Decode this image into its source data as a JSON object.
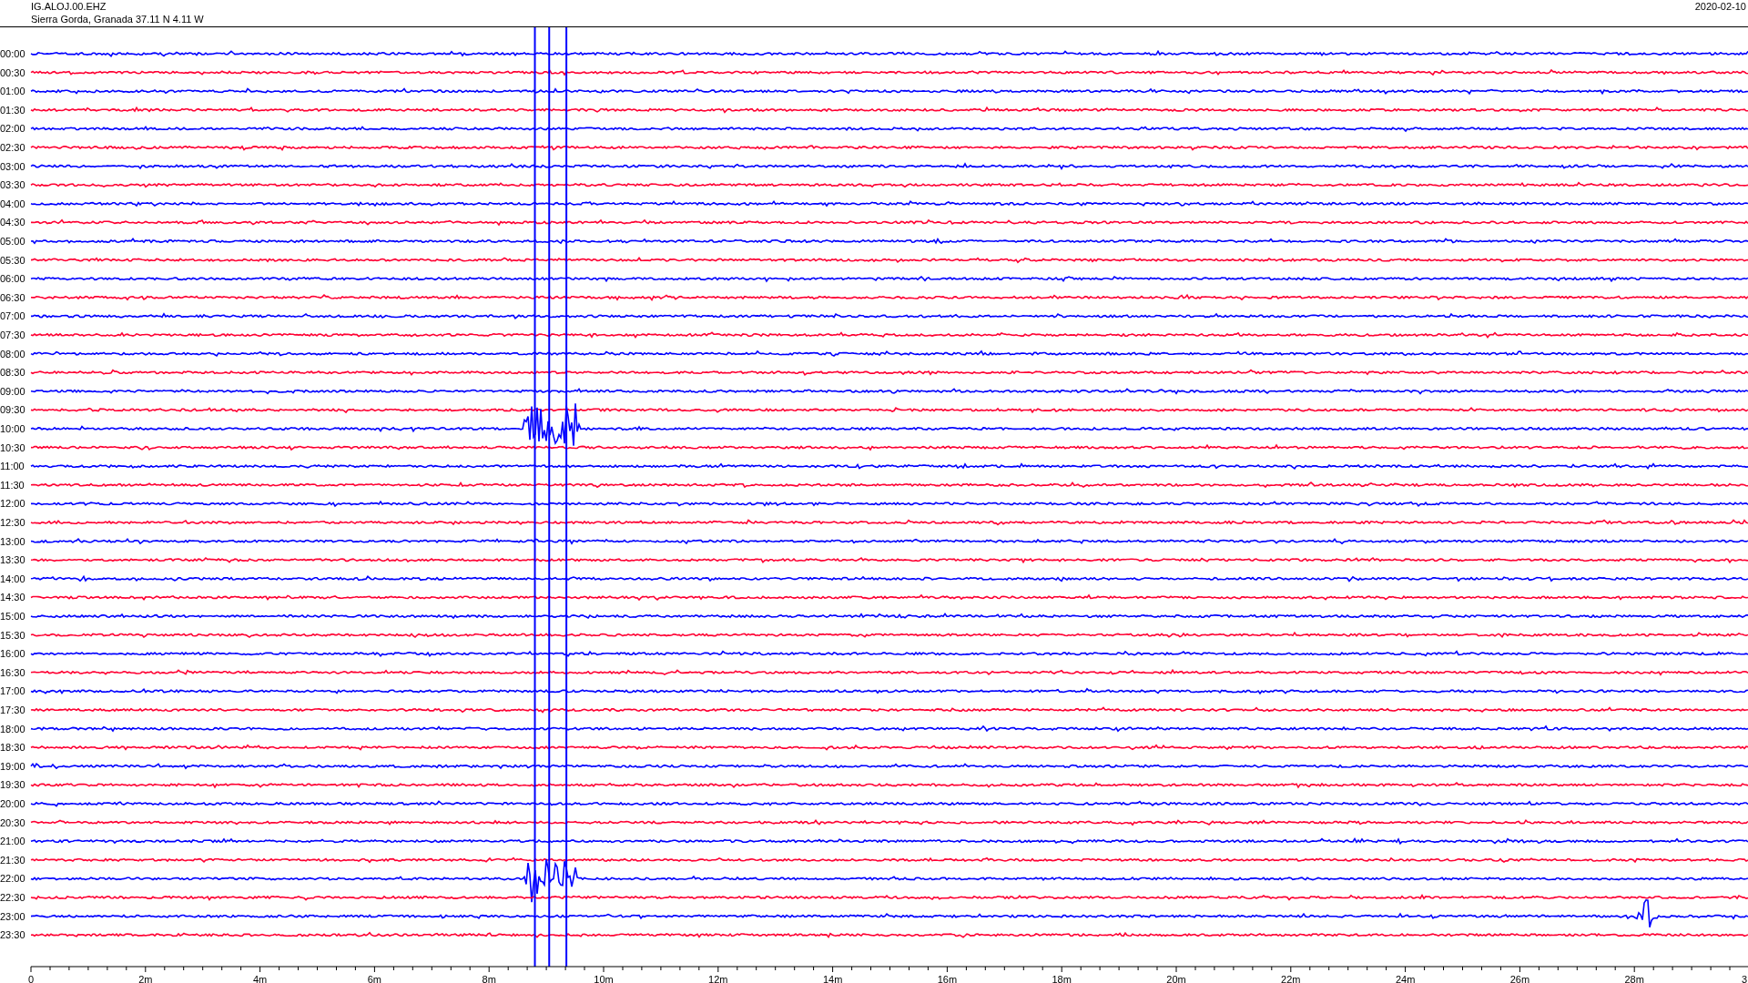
{
  "header": {
    "station": "IG.ALOJ.00.EHZ",
    "location": "Sierra Gorda, Granada  37.11 N 4.11 W",
    "date": "2020-02-10"
  },
  "rows": [
    {
      "label": "00:00",
      "color": "#0000ff"
    },
    {
      "label": "00:30",
      "color": "#ff0033"
    },
    {
      "label": "01:00",
      "color": "#0000ff"
    },
    {
      "label": "01:30",
      "color": "#ff0033"
    },
    {
      "label": "02:00",
      "color": "#0000ff"
    },
    {
      "label": "02:30",
      "color": "#ff0033"
    },
    {
      "label": "03:00",
      "color": "#0000ff"
    },
    {
      "label": "03:30",
      "color": "#ff0033"
    },
    {
      "label": "04:00",
      "color": "#0000ff"
    },
    {
      "label": "04:30",
      "color": "#ff0033"
    },
    {
      "label": "05:00",
      "color": "#0000ff"
    },
    {
      "label": "05:30",
      "color": "#ff0033"
    },
    {
      "label": "06:00",
      "color": "#0000ff"
    },
    {
      "label": "06:30",
      "color": "#ff0033"
    },
    {
      "label": "07:00",
      "color": "#0000ff"
    },
    {
      "label": "07:30",
      "color": "#ff0033"
    },
    {
      "label": "08:00",
      "color": "#0000ff"
    },
    {
      "label": "08:30",
      "color": "#ff0033"
    },
    {
      "label": "09:00",
      "color": "#0000ff"
    },
    {
      "label": "09:30",
      "color": "#ff0033"
    },
    {
      "label": "10:00",
      "color": "#0000ff"
    },
    {
      "label": "10:30",
      "color": "#ff0033"
    },
    {
      "label": "11:00",
      "color": "#0000ff"
    },
    {
      "label": "11:30",
      "color": "#ff0033"
    },
    {
      "label": "12:00",
      "color": "#0000ff"
    },
    {
      "label": "12:30",
      "color": "#ff0033"
    },
    {
      "label": "13:00",
      "color": "#0000ff"
    },
    {
      "label": "13:30",
      "color": "#ff0033"
    },
    {
      "label": "14:00",
      "color": "#0000ff"
    },
    {
      "label": "14:30",
      "color": "#ff0033"
    },
    {
      "label": "15:00",
      "color": "#0000ff"
    },
    {
      "label": "15:30",
      "color": "#ff0033"
    },
    {
      "label": "16:00",
      "color": "#0000ff"
    },
    {
      "label": "16:30",
      "color": "#ff0033"
    },
    {
      "label": "17:00",
      "color": "#0000ff"
    },
    {
      "label": "17:30",
      "color": "#ff0033"
    },
    {
      "label": "18:00",
      "color": "#0000ff"
    },
    {
      "label": "18:30",
      "color": "#ff0033"
    },
    {
      "label": "19:00",
      "color": "#0000ff"
    },
    {
      "label": "19:30",
      "color": "#ff0033"
    },
    {
      "label": "20:00",
      "color": "#0000ff"
    },
    {
      "label": "20:30",
      "color": "#ff0033"
    },
    {
      "label": "21:00",
      "color": "#0000ff"
    },
    {
      "label": "21:30",
      "color": "#ff0033"
    },
    {
      "label": "22:00",
      "color": "#0000ff"
    },
    {
      "label": "22:30",
      "color": "#ff0033"
    },
    {
      "label": "23:00",
      "color": "#0000ff"
    },
    {
      "label": "23:30",
      "color": "#ff0033"
    }
  ],
  "axis": {
    "labels": [
      "0",
      "2m",
      "4m",
      "6m",
      "8m",
      "10m",
      "12m",
      "14m",
      "16m",
      "18m",
      "20m",
      "22m",
      "24m",
      "26m",
      "28m",
      "3"
    ]
  }
}
